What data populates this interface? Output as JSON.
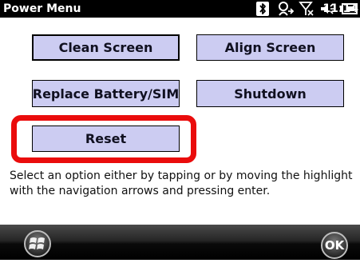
{
  "titlebar": {
    "title": "Power Menu",
    "time": "11:14",
    "icons": [
      "bluetooth-icon",
      "connectivity-icon",
      "no-signal-icon",
      "volume-icon",
      "battery-icon"
    ]
  },
  "buttons": {
    "clean_screen": "Clean Screen",
    "align_screen": "Align Screen",
    "replace_battery": "Replace Battery/SIM",
    "shutdown": "Shutdown",
    "reset": "Reset"
  },
  "instruction": "Select an option either by tapping or by moving the highlight with the navigation arrows and pressing enter.",
  "softkeys": {
    "start": "windows-start-icon",
    "ok": "OK"
  },
  "colors": {
    "button_fill": "#ccccf2",
    "highlight_border": "#ea0c0c",
    "titlebar_bg": "#000000"
  }
}
